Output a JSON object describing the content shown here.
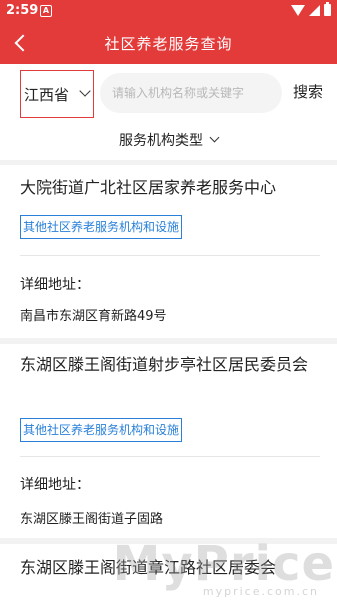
{
  "status_bar": {
    "time": "2:59",
    "notification": "A",
    "icons": [
      "wifi-icon",
      "signal-icon",
      "battery-icon"
    ]
  },
  "header": {
    "title": "社区养老服务查询",
    "color": "#e33a3a"
  },
  "search": {
    "province": "江西省",
    "placeholder": "请输入机构名称或关键字",
    "button": "搜索"
  },
  "filter": {
    "type_label": "服务机构类型"
  },
  "results": [
    {
      "name": "大院街道广北社区居家养老服务中心",
      "tag": "其他社区养老服务机构和设施",
      "address_label": "详细地址：",
      "address": "南昌市东湖区育新路49号"
    },
    {
      "name": "东湖区滕王阁街道射步亭社区居民委员会",
      "tag": "其他社区养老服务机构和设施",
      "address_label": "详细地址：",
      "address": "东湖区滕王阁街道子固路"
    },
    {
      "name": "东湖区滕王阁街道章江路社区居委会"
    }
  ],
  "watermark": {
    "text": "MyPrice",
    "sub": "myprice.com.cn"
  },
  "colors": {
    "accent": "#e33a3a",
    "tag_blue": "#2a80d9",
    "background": "#f2f2f2"
  }
}
